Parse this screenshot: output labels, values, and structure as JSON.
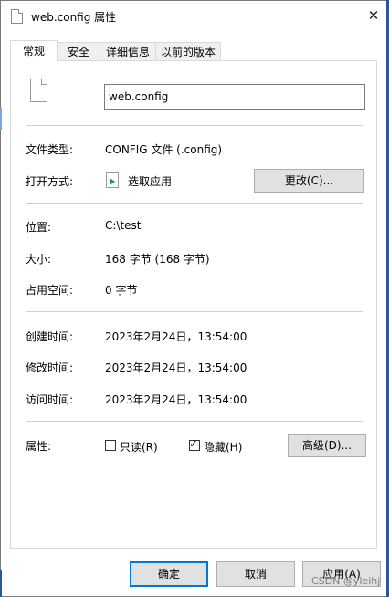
{
  "window": {
    "title": "web.config 属性",
    "close_glyph": "✕"
  },
  "tabs": [
    {
      "label": "常规",
      "active": true
    },
    {
      "label": "安全",
      "active": false
    },
    {
      "label": "详细信息",
      "active": false
    },
    {
      "label": "以前的版本",
      "active": false
    }
  ],
  "general": {
    "file_name": "web.config",
    "file_type_label": "文件类型:",
    "file_type_value": "CONFIG 文件 (.config)",
    "opens_with_label": "打开方式:",
    "opens_with_value": "选取应用",
    "change_button": "更改(C)...",
    "location_label": "位置:",
    "location_value": "C:\\test",
    "size_label": "大小:",
    "size_value": "168 字节 (168 字节)",
    "size_on_disk_label": "占用空间:",
    "size_on_disk_value": "0 字节",
    "created_label": "创建时间:",
    "created_value": "2023年2月24日，13:54:00",
    "modified_label": "修改时间:",
    "modified_value": "2023年2月24日，13:54:00",
    "accessed_label": "访问时间:",
    "accessed_value": "2023年2月24日，13:54:00",
    "attributes_label": "属性:",
    "readonly_label": "只读(R)",
    "readonly_checked": false,
    "hidden_label": "隐藏(H)",
    "hidden_checked": true,
    "check_glyph": "✓",
    "advanced_button": "高级(D)..."
  },
  "footer": {
    "ok_button": "确定",
    "cancel_button": "取消",
    "apply_button": "应用(A)"
  },
  "watermark": "CSDN @yleihj"
}
